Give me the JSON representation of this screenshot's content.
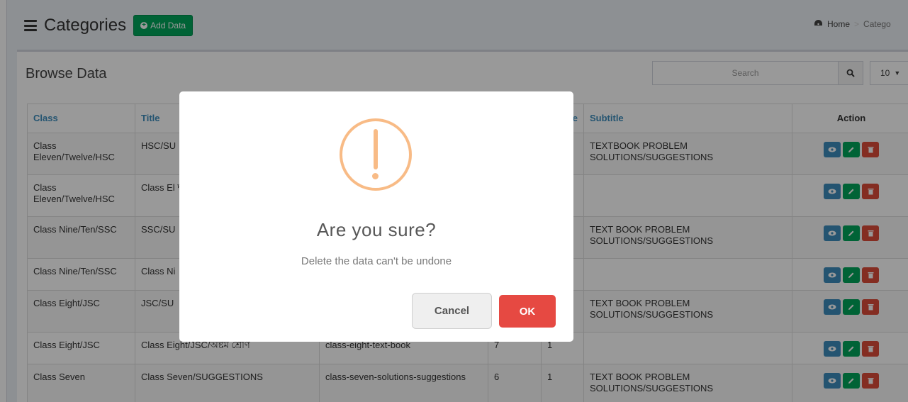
{
  "header": {
    "title": "Categories",
    "add_button": "Add Data"
  },
  "breadcrumb": {
    "home": "Home",
    "current": "Catego"
  },
  "box": {
    "title": "Browse Data",
    "search_placeholder": "Search",
    "per_page": "10"
  },
  "table": {
    "headers": [
      "Class",
      "Title",
      "",
      "",
      "e",
      "Subtitle",
      "Action"
    ],
    "rows": [
      [
        "Class Eleven/Twelve/HSC",
        "HSC/SU",
        "",
        "",
        "",
        "TEXTBOOK PROBLEM SOLUTIONS/SUGGESTIONS"
      ],
      [
        "Class Eleven/Twelve/HSC",
        "Class El দ্বাদশ শ্রে",
        "",
        "",
        "",
        ""
      ],
      [
        "Class Nine/Ten/SSC",
        "SSC/SU",
        "",
        "",
        "",
        "TEXT BOOK PROBLEM SOLUTIONS/SUGGESTIONS"
      ],
      [
        "Class Nine/Ten/SSC",
        "Class Ni",
        "",
        "",
        "",
        ""
      ],
      [
        "Class Eight/JSC",
        "JSC/SU",
        "",
        "",
        "",
        "TEXT BOOK PROBLEM SOLUTIONS/SUGGESTIONS"
      ],
      [
        "Class Eight/JSC",
        "Class Eight/JSC/অষ্টম শ্রেণি",
        "class-eight-text-book",
        "7",
        "1",
        ""
      ],
      [
        "Class Seven",
        "Class Seven/SUGGESTIONS",
        "class-seven-solutions-suggestions",
        "6",
        "1",
        "TEXT BOOK PROBLEM SOLUTIONS/SUGGESTIONS"
      ]
    ]
  },
  "modal": {
    "title": "Are you sure?",
    "text": "Delete the data can't be undone",
    "cancel_label": "Cancel",
    "ok_label": "OK"
  },
  "colors": {
    "primary": "#3c8dbc",
    "success": "#00a65a",
    "danger": "#dd4b39",
    "warning_icon": "#f8bb86",
    "ok_button": "#e64942"
  },
  "icons": {
    "menu": "hamburger-icon",
    "add": "plus-circle-icon",
    "home": "dashboard-icon",
    "search": "search-icon",
    "view": "eye-icon",
    "edit": "pencil-icon",
    "delete": "trash-icon",
    "warning": "exclamation-icon"
  }
}
